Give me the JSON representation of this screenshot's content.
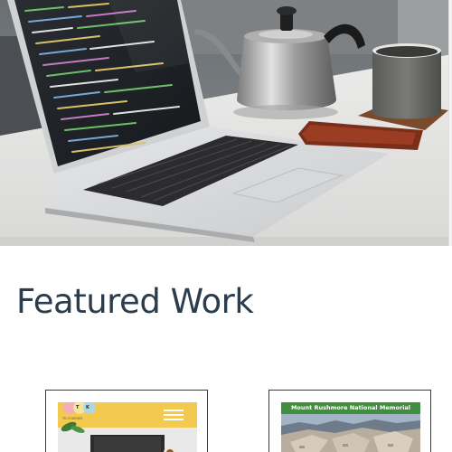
{
  "hero": {
    "image": "laptop-coffee-workspace-photo"
  },
  "featured": {
    "title": "Featured Work"
  },
  "cards": [
    {
      "id": "work-1",
      "thumb_letters": [
        "T",
        "K"
      ],
      "thumb_subtitle": "TK COURSES",
      "icon": "hamburger-menu-icon"
    },
    {
      "id": "work-2",
      "thumb_title": "Mount Rushmore National Memorial"
    }
  ],
  "colors": {
    "title": "#2b3c4d",
    "card_border": "#3a3a3a",
    "yellow_header": "#f3c94f",
    "green_banner": "#3f8f3f"
  }
}
